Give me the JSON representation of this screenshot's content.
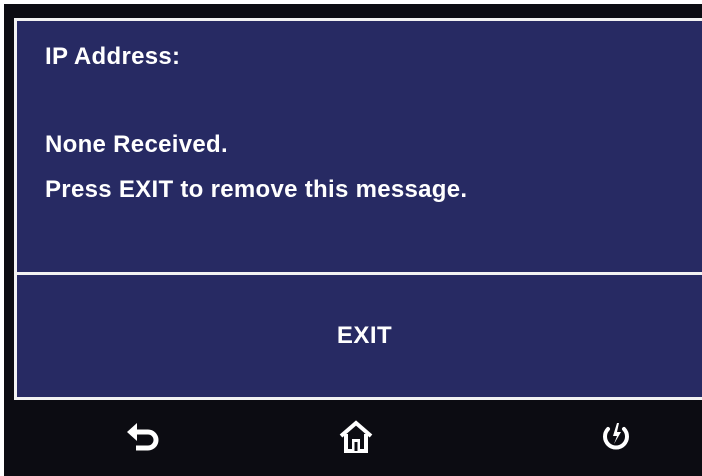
{
  "dialog": {
    "title": "IP Address:",
    "message_line_1": "None Received.",
    "message_line_2": "Press EXIT to remove this message.",
    "exit_label": "EXIT"
  },
  "nav": {
    "back_icon": "back-arrow-icon",
    "home_icon": "home-icon",
    "power_icon": "power-icon"
  },
  "colors": {
    "panel_background": "#272a63",
    "screen_background": "#0c0c12",
    "text": "#ffffff",
    "border": "#f2f2f2"
  }
}
